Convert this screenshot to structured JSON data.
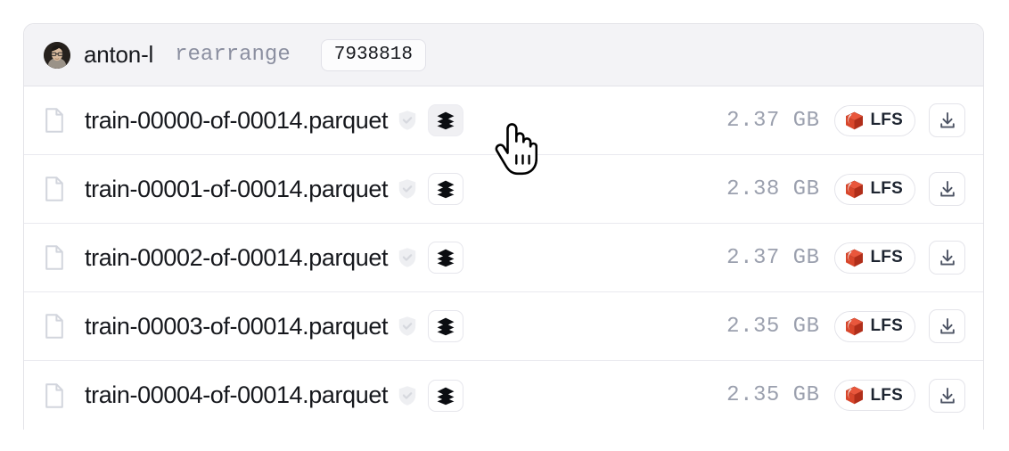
{
  "header": {
    "author": "anton-l",
    "branch": "rearrange",
    "commit": "7938818",
    "avatar_icon": "user-avatar-photo"
  },
  "icons": {
    "file": "file-icon",
    "shield_check": "shield-check-icon",
    "dataset_viewer": "layers-stack-icon",
    "lfs": "lfs-box-icon",
    "download": "download-icon",
    "cursor": "pointer-hand-cursor"
  },
  "labels": {
    "lfs": "LFS"
  },
  "colors": {
    "lfs_red": "#d8462b",
    "lfs_red_dark": "#b02e1a",
    "text": "#16181d",
    "muted": "#9ba0ae",
    "border": "#e3e3e8",
    "header_bg": "#f3f3f6"
  },
  "files": [
    {
      "name": "train-00000-of-00014.parquet",
      "size": "2.37 GB",
      "storage": "LFS",
      "viewer_hovered": true
    },
    {
      "name": "train-00001-of-00014.parquet",
      "size": "2.38 GB",
      "storage": "LFS",
      "viewer_hovered": false
    },
    {
      "name": "train-00002-of-00014.parquet",
      "size": "2.37 GB",
      "storage": "LFS",
      "viewer_hovered": false
    },
    {
      "name": "train-00003-of-00014.parquet",
      "size": "2.35 GB",
      "storage": "LFS",
      "viewer_hovered": false
    },
    {
      "name": "train-00004-of-00014.parquet",
      "size": "2.35 GB",
      "storage": "LFS",
      "viewer_hovered": false
    }
  ]
}
